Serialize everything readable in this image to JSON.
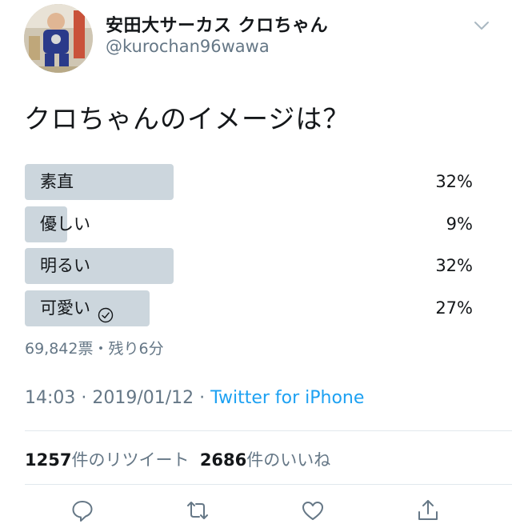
{
  "user": {
    "display_name": "安田大サーカス クロちゃん",
    "handle": "@kurochan96wawa"
  },
  "tweet": {
    "text": "クロちゃんのイメージは？"
  },
  "poll": {
    "options": [
      {
        "label": "素直",
        "percent": "32%",
        "fraction": 0.32,
        "selected": false
      },
      {
        "label": "優しい",
        "percent": "9%",
        "fraction": 0.09,
        "selected": false
      },
      {
        "label": "明るい",
        "percent": "32%",
        "fraction": 0.32,
        "selected": false
      },
      {
        "label": "可愛い",
        "percent": "27%",
        "fraction": 0.27,
        "selected": true
      }
    ],
    "meta": "69,842票・残り6分"
  },
  "timestamp": {
    "time_date": "14:03 · 2019/01/12 · ",
    "source": "Twitter for iPhone"
  },
  "stats": {
    "retweets_count": "1257",
    "retweets_label": "件のリツイート",
    "likes_count": "2686",
    "likes_label": "件のいいね"
  },
  "colors": {
    "bar": "#ccd6dd",
    "muted": "#657786",
    "link": "#1da1f2",
    "text": "#14171a"
  },
  "icons": {
    "reply": "reply-icon",
    "retweet": "retweet-icon",
    "like": "like-icon",
    "share": "share-icon",
    "caret": "chevron-down-icon",
    "check": "check-circle-icon"
  }
}
